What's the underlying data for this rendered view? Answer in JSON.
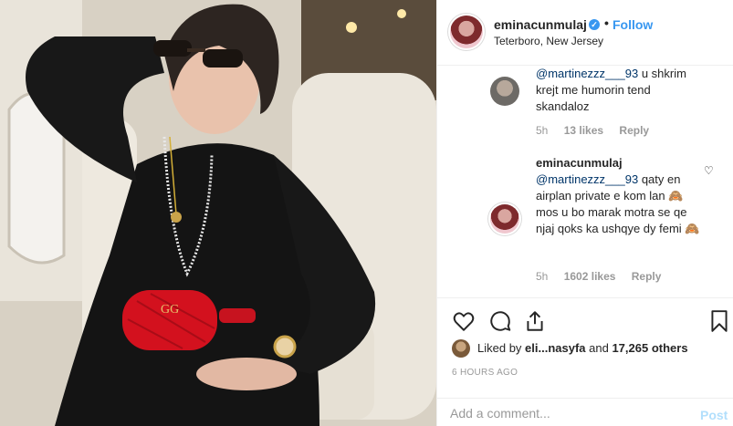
{
  "header": {
    "username": "eminacunmulaj",
    "verified_mark": "✓",
    "separator": "•",
    "follow_label": "Follow",
    "location": "Teterboro, New Jersey"
  },
  "comments": [
    {
      "avatar_icon": "user-avatar",
      "mention": "@martinezzz___93",
      "text": " u shkrim krejt me humorin tend skandaloz",
      "time": "5h",
      "likes": "13 likes",
      "reply": "Reply"
    },
    {
      "avatar_icon": "user-avatar",
      "username": "eminacunmulaj",
      "mention": "@martinezzz___93",
      "text": " qaty en airplan private e kom lan 🙈 mos u bo marak motra se qe njaj qoks ka ushqye dy femi 🙈",
      "time": "5h",
      "likes": "1602 likes",
      "reply": "Reply",
      "heart_icon": "♡"
    }
  ],
  "actions": {
    "like_icon": "heart-icon",
    "comment_icon": "comment-icon",
    "share_icon": "share-icon",
    "save_icon": "bookmark-icon"
  },
  "likes_summary": {
    "prefix": "Liked by ",
    "names": "eli...nasyfa",
    "and": " and ",
    "count": "17,265 others"
  },
  "timestamp": "6 HOURS AGO",
  "add_comment": {
    "placeholder": "Add a comment...",
    "post_label": "Post"
  }
}
